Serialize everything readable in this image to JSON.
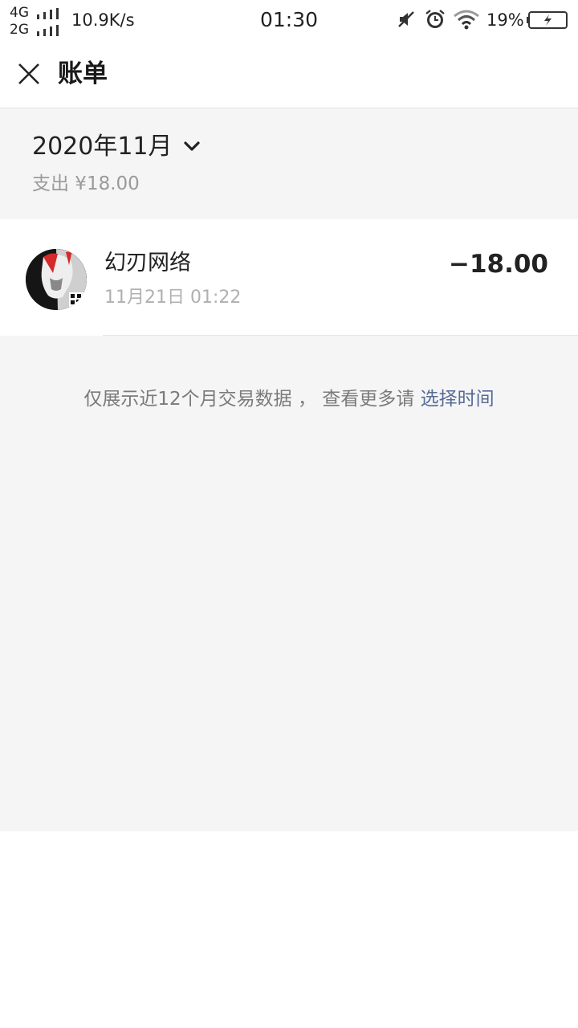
{
  "status_bar": {
    "network_1": "4G",
    "network_2": "2G",
    "speed": "10.9K/s",
    "time": "01:30",
    "battery_percent": "19%",
    "icons": [
      "signal-icon",
      "mute-icon",
      "alarm-icon",
      "wifi-icon",
      "battery-charging-icon"
    ]
  },
  "header": {
    "close_icon": "close-icon",
    "title": "账单"
  },
  "month": {
    "label": "2020年11月",
    "chevron_icon": "chevron-down-icon",
    "summary": "支出 ¥18.00"
  },
  "transactions": [
    {
      "merchant": "幻刃网络",
      "time": "11月21日 01:22",
      "amount": "−18.00"
    }
  ],
  "footer": {
    "notice_text": "仅展示近12个月交易数据 ， 查看更多请 ",
    "notice_link": "选择时间",
    "link_color": "#576b95"
  },
  "colors": {
    "background_gray": "#f5f5f5",
    "text_primary": "#222222",
    "text_secondary": "#9a9a9a",
    "link": "#576b95"
  }
}
